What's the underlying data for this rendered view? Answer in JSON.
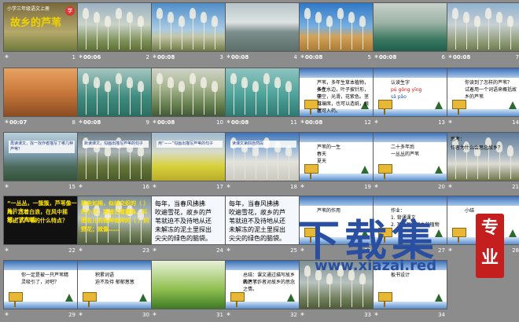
{
  "slides": [
    {
      "num": "1",
      "time": "",
      "theme": "title",
      "title_text": "故乡的芦苇",
      "subtitle_text": "小学三年级语文上册",
      "emblem": "学"
    },
    {
      "num": "2",
      "time": "00:06",
      "theme": "reed-light"
    },
    {
      "num": "3",
      "time": "00:08",
      "theme": "sky"
    },
    {
      "num": "4",
      "time": "00:08",
      "theme": "water"
    },
    {
      "num": "5",
      "time": "00:08",
      "theme": "blue"
    },
    {
      "num": "6",
      "time": "00:08",
      "theme": "green"
    },
    {
      "num": "7",
      "time": "00:08",
      "theme": "dusk"
    },
    {
      "num": "8",
      "time": "00:07",
      "theme": "sunset"
    },
    {
      "num": "9",
      "time": "00:08",
      "theme": "teal"
    },
    {
      "num": "10",
      "time": "00:08",
      "theme": "grass"
    },
    {
      "num": "11",
      "time": "00:08",
      "theme": "teal2"
    },
    {
      "num": "12",
      "time": "00:08",
      "theme": "slide",
      "lines": [
        "芦苇，多年生草本植物，多生",
        "长在水边，叶子披针形，茎",
        "中空，光滑，花紫色。茎可",
        "以编席，也可以造纸，根状",
        "茎可入药。"
      ]
    },
    {
      "num": "13",
      "time": "",
      "theme": "slide",
      "lines": [
        "认读生字",
        "pú gōng yīng",
        "sā pǎo"
      ]
    },
    {
      "num": "14",
      "time": "",
      "theme": "slide",
      "lines": [
        "你读到了怎样的芦苇？",
        "试着用一个词语来概括故乡的芦苇"
      ]
    },
    {
      "num": "15",
      "time": "",
      "theme": "pond",
      "caption": "再读课文，找一找作者描写了哪几种芦苇？"
    },
    {
      "num": "16",
      "time": "",
      "theme": "dark",
      "caption": "默读课文，勾画出描写芦苇的句子"
    },
    {
      "num": "17",
      "time": "",
      "theme": "field",
      "caption": "用“——”勾画出描写芦苇的句子"
    },
    {
      "num": "18",
      "time": "",
      "theme": "cotton",
      "caption": "读课文第四自然段"
    },
    {
      "num": "19",
      "time": "",
      "theme": "slide",
      "lines": [
        "芦苇的一生",
        "春天",
        "夏天"
      ]
    },
    {
      "num": "20",
      "time": "",
      "theme": "slide",
      "lines": [
        "二十多年后",
        "一丛丛的芦苇"
      ]
    },
    {
      "num": "21",
      "time": "",
      "theme": "fields2",
      "lines": [
        "思考：",
        "作者为什么会思念故乡？"
      ]
    },
    {
      "num": "22",
      "time": "",
      "theme": "blackbox",
      "lines": [
        "“一丛丛，一簇簇，芦苇像一片片大",
        "海，泛着白浪，在风中摇摆。”这句话",
        "写出了芦苇的什么特点？"
      ]
    },
    {
      "num": "23",
      "time": "",
      "theme": "rain",
      "lines": [
        "那些如棉，似绒交织的（ ）",
        "的小河；那被沾着露珠、叫不",
        "出名儿的各种各样的（ ）的",
        "野花；就像……"
      ]
    },
    {
      "num": "24",
      "time": "",
      "theme": "white",
      "lines": [
        "每年，当春风拂拂",
        "吹遍雪花，故乡的芦",
        "苇就迫不及待地从还",
        "未解冻的泥土里探出",
        "尖尖的绿色的脑袋。"
      ]
    },
    {
      "num": "25",
      "time": "",
      "theme": "white",
      "lines": [
        "每年，当春风拂拂",
        "吹遍雪花，故乡的芦",
        "苇就迫不及待地从还",
        "未解冻的泥土里探出",
        "尖尖的绿色的脑袋。"
      ]
    },
    {
      "num": "26",
      "time": "",
      "theme": "slide",
      "lines": [
        "芦苇的作用"
      ]
    },
    {
      "num": "27",
      "time": "",
      "theme": "slide",
      "lines": [
        "作业：",
        "1. 背诵课文",
        "2. 写一写你家乡的植物"
      ]
    },
    {
      "num": "28",
      "time": "",
      "theme": "slide",
      "lines": [
        "小结"
      ]
    },
    {
      "num": "29",
      "time": "",
      "theme": "slide",
      "lines": [
        "你一定是被一只芦苇精",
        "灵吸引了，对吧？"
      ]
    },
    {
      "num": "30",
      "time": "",
      "theme": "slide",
      "lines": [
        "积累词语",
        "迫不及待 郁郁葱葱"
      ]
    },
    {
      "num": "31",
      "time": "",
      "theme": "leaf"
    },
    {
      "num": "32",
      "time": "",
      "theme": "slide",
      "lines": [
        "总结：课文通过描写故乡的芦苇，",
        "表达了作者对故乡的思念之情。"
      ]
    },
    {
      "num": "33",
      "time": "",
      "theme": "rain"
    },
    {
      "num": "34",
      "time": "",
      "theme": "slide",
      "lines": [
        "板书设计"
      ]
    }
  ],
  "watermark": {
    "big_text": "下载集",
    "url": "www.xiazai.red",
    "seal_text": "专业"
  }
}
